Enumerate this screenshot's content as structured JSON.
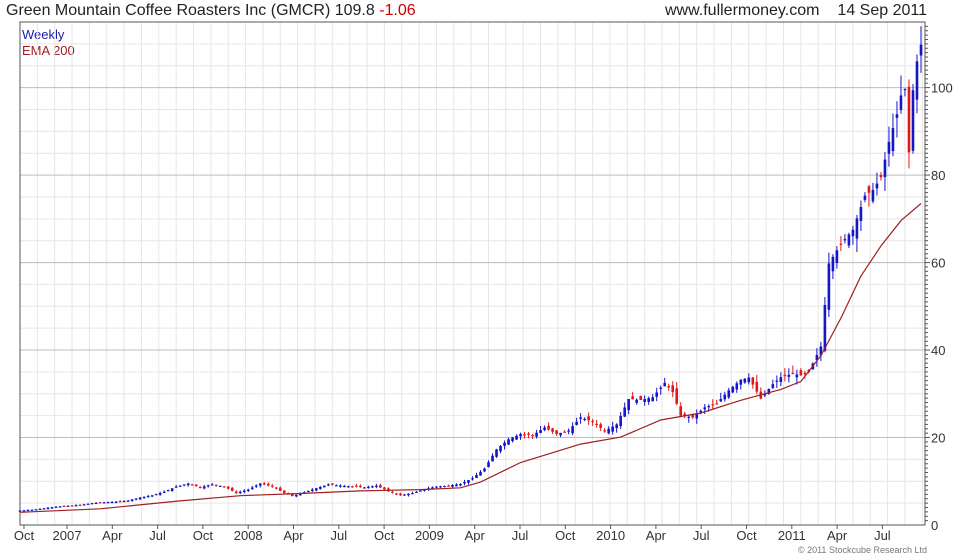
{
  "header": {
    "company": "Green Mountain Coffee Roasters Inc (GMCR)",
    "price": "109.8",
    "change": "-1.06",
    "site": "www.fullermoney.com",
    "date": "14 Sep 2011"
  },
  "credit": "© 2011 Stockcube Research Ltd",
  "colors": {
    "up": "#1414c8",
    "down": "#e01818",
    "ema": "#a02020",
    "grid": "#d8d8d8",
    "frame": "#555555"
  },
  "chart_data": {
    "type": "line",
    "legend": [
      "Weekly",
      "EMA 200"
    ],
    "legend_position": "top-left",
    "x_tick_labels": [
      "Oct",
      "2007",
      "Apr",
      "Jul",
      "Oct",
      "2008",
      "Apr",
      "Jul",
      "Oct",
      "2009",
      "Apr",
      "Jul",
      "Oct",
      "2010",
      "Apr",
      "Jul",
      "Oct",
      "2011",
      "Apr",
      "Jul"
    ],
    "y_ticks": [
      0,
      20,
      40,
      60,
      80,
      100
    ],
    "ylim": [
      0,
      115
    ],
    "grid": true,
    "series": [
      {
        "name": "Weekly",
        "note": "weekly closes, blue candles up / red candles down",
        "points": [
          [
            0,
            3.3
          ],
          [
            3,
            3.5
          ],
          [
            6,
            3.8
          ],
          [
            9,
            4.2
          ],
          [
            12,
            4.4
          ],
          [
            15,
            4.6
          ],
          [
            18,
            5.0
          ],
          [
            21,
            5.2
          ],
          [
            24,
            5.3
          ],
          [
            27,
            5.6
          ],
          [
            30,
            6.3
          ],
          [
            33,
            6.8
          ],
          [
            36,
            7.6
          ],
          [
            39,
            8.8
          ],
          [
            42,
            9.5
          ],
          [
            45,
            8.6
          ],
          [
            48,
            9.3
          ],
          [
            51,
            8.8
          ],
          [
            54,
            7.3
          ],
          [
            57,
            8.1
          ],
          [
            60,
            9.5
          ],
          [
            63,
            8.8
          ],
          [
            66,
            7.3
          ],
          [
            68,
            6.6
          ],
          [
            71,
            7.5
          ],
          [
            74,
            8.4
          ],
          [
            77,
            9.3
          ],
          [
            80,
            9.0
          ],
          [
            83,
            8.8
          ],
          [
            86,
            8.6
          ],
          [
            89,
            9.0
          ],
          [
            92,
            7.7
          ],
          [
            95,
            6.8
          ],
          [
            98,
            7.3
          ],
          [
            101,
            8.2
          ],
          [
            104,
            8.8
          ],
          [
            107,
            9.0
          ],
          [
            110,
            9.4
          ],
          [
            113,
            10.7
          ],
          [
            116,
            12.9
          ],
          [
            119,
            17.3
          ],
          [
            122,
            19.6
          ],
          [
            125,
            20.8
          ],
          [
            128,
            20.5
          ],
          [
            131,
            22.3
          ],
          [
            134,
            20.8
          ],
          [
            137,
            21.6
          ],
          [
            140,
            24.6
          ],
          [
            143,
            23.6
          ],
          [
            146,
            21.5
          ],
          [
            149,
            23.0
          ],
          [
            152,
            28.8
          ],
          [
            155,
            28.6
          ],
          [
            158,
            29.2
          ],
          [
            161,
            32.5
          ],
          [
            163,
            30.4
          ],
          [
            165,
            25.0
          ],
          [
            168,
            24.6
          ],
          [
            171,
            26.9
          ],
          [
            174,
            27.8
          ],
          [
            177,
            30.8
          ],
          [
            180,
            33.2
          ],
          [
            182,
            33.7
          ],
          [
            185,
            28.9
          ],
          [
            188,
            32.2
          ],
          [
            190,
            33.8
          ],
          [
            193,
            34.6
          ],
          [
            195,
            34.2
          ],
          [
            197,
            35.0
          ],
          [
            200,
            40.8
          ],
          [
            202,
            59.8
          ],
          [
            205,
            64.3
          ],
          [
            208,
            67.5
          ],
          [
            211,
            75.3
          ],
          [
            213,
            76.6
          ],
          [
            215,
            79.5
          ],
          [
            217,
            87.6
          ],
          [
            219,
            93.9
          ],
          [
            220,
            98.2
          ],
          [
            221,
            99.7
          ],
          [
            222,
            85.2
          ],
          [
            223,
            99.4
          ],
          [
            224,
            106.0
          ],
          [
            225,
            109.8
          ]
        ]
      },
      {
        "name": "EMA 200",
        "points": [
          [
            0,
            2.9
          ],
          [
            20,
            3.7
          ],
          [
            40,
            5.5
          ],
          [
            55,
            6.7
          ],
          [
            70,
            7.2
          ],
          [
            85,
            7.8
          ],
          [
            100,
            8.1
          ],
          [
            110,
            8.5
          ],
          [
            115,
            9.8
          ],
          [
            125,
            14.3
          ],
          [
            140,
            18.5
          ],
          [
            150,
            20.1
          ],
          [
            160,
            24.0
          ],
          [
            170,
            25.6
          ],
          [
            180,
            28.5
          ],
          [
            190,
            31.0
          ],
          [
            195,
            32.8
          ],
          [
            200,
            38.7
          ],
          [
            205,
            47.3
          ],
          [
            210,
            56.9
          ],
          [
            215,
            63.8
          ],
          [
            220,
            69.6
          ],
          [
            225,
            73.5
          ]
        ]
      }
    ]
  }
}
